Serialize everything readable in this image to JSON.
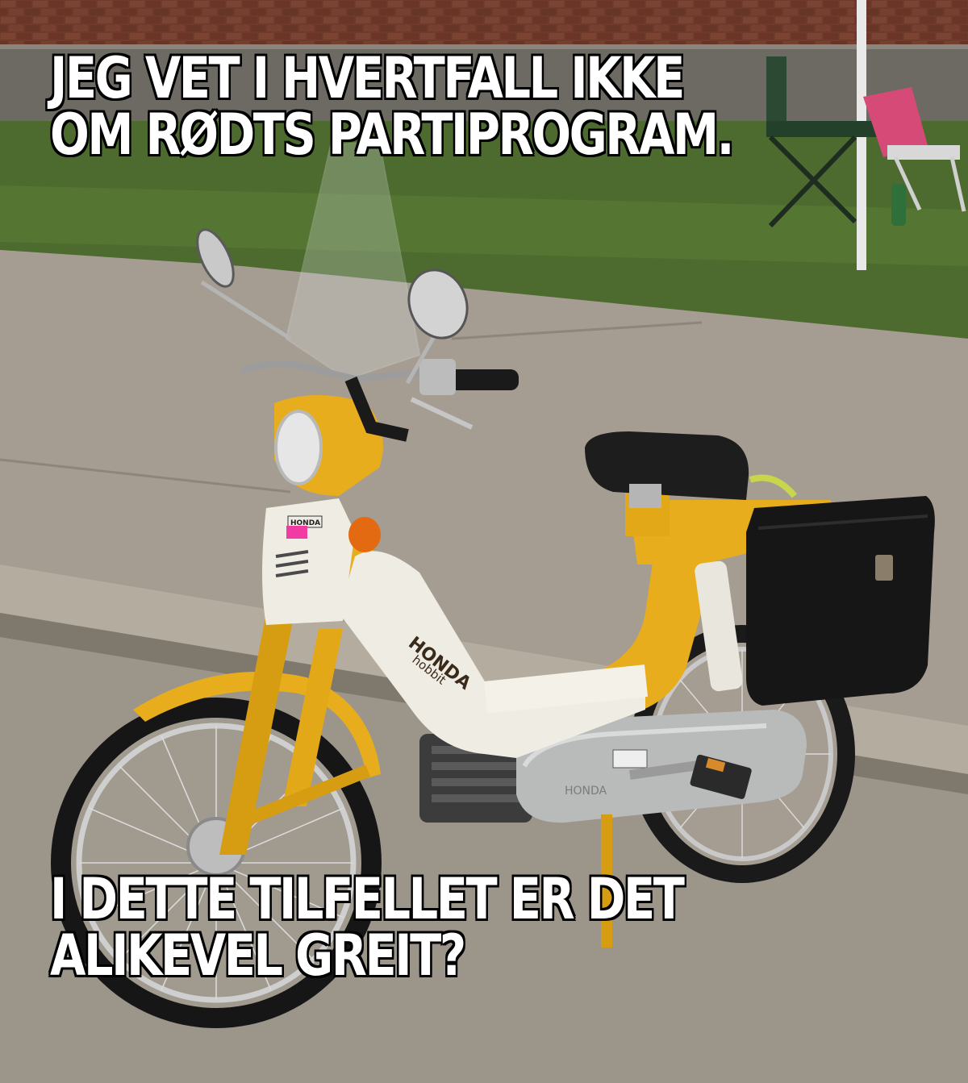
{
  "meme": {
    "top_lines": [
      "JEG VET I HVERTFALL IKKE",
      "OM RØDTS PARTIPROGRAM."
    ],
    "bottom_lines": [
      "I DETTE TILFELLET ER DET",
      "ALIKEVEL GREIT?"
    ]
  },
  "photo": {
    "subject": "yellow-white moped on sidewalk",
    "badge_text": "HONDA",
    "tank_brand": "HONDA",
    "tank_model": "hobbit",
    "engine_brand": "HONDA",
    "colors": {
      "body_yellow": "#e8ad1c",
      "body_white": "#efece4",
      "seat_black": "#1d1d1d",
      "pavement": "#a59d91",
      "grass": "#4d6b2f",
      "brick": "#6e3a2b"
    }
  }
}
